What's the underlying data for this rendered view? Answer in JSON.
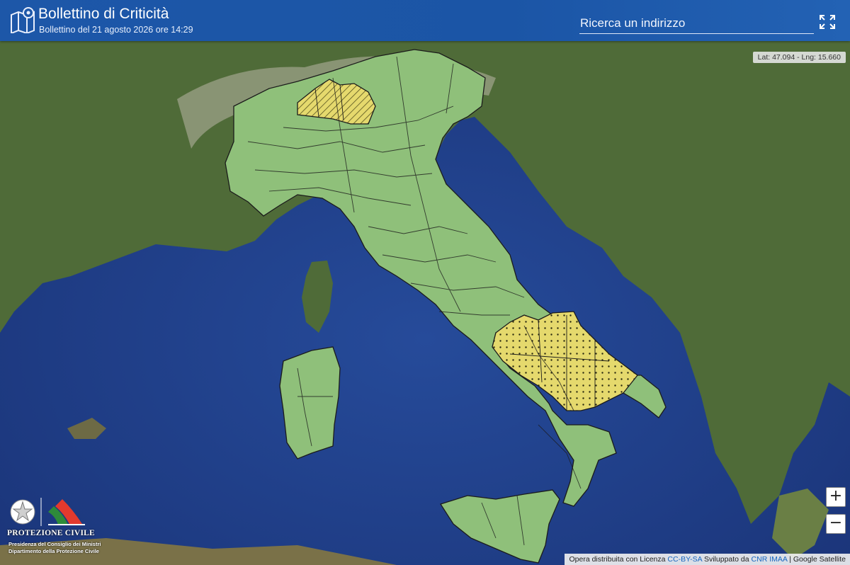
{
  "header": {
    "title": "Bollettino di Criticità",
    "subtitle": "Bollettino del 21 agosto 2026 ore 14:29",
    "search_placeholder": "Ricerca un indirizzo"
  },
  "map": {
    "coordinates": "Lat: 47.094 - Lng: 15.660",
    "base_layer": "satellite",
    "alert_zones": [
      {
        "area": "Lombardia (nord)",
        "level": "gialla",
        "pattern": "striped",
        "color": "#e5d96d"
      },
      {
        "area": "Campania / Basilicata / Puglia (nord)",
        "level": "gialla",
        "pattern": "dotted",
        "color": "#e5d96d"
      }
    ],
    "default_zone_color": "#8fc07a",
    "zoom_in_label": "+",
    "zoom_out_label": "−"
  },
  "footer": {
    "prefix": "Opera distribuita con Licenza",
    "license_link": "CC-BY-SA",
    "developed_by": "Sviluppato da",
    "developer_link": "CNR IMAA",
    "imagery": "| Google Satellite"
  },
  "branding": {
    "name": "PROTEZIONE CIVILE",
    "line1": "Presidenza del Consiglio dei Ministri",
    "line2": "Dipartimento della Protezione Civile"
  },
  "colors": {
    "header_bg": "#1d57a8",
    "sea": "#1f3d86",
    "land": "#4f6b38"
  }
}
